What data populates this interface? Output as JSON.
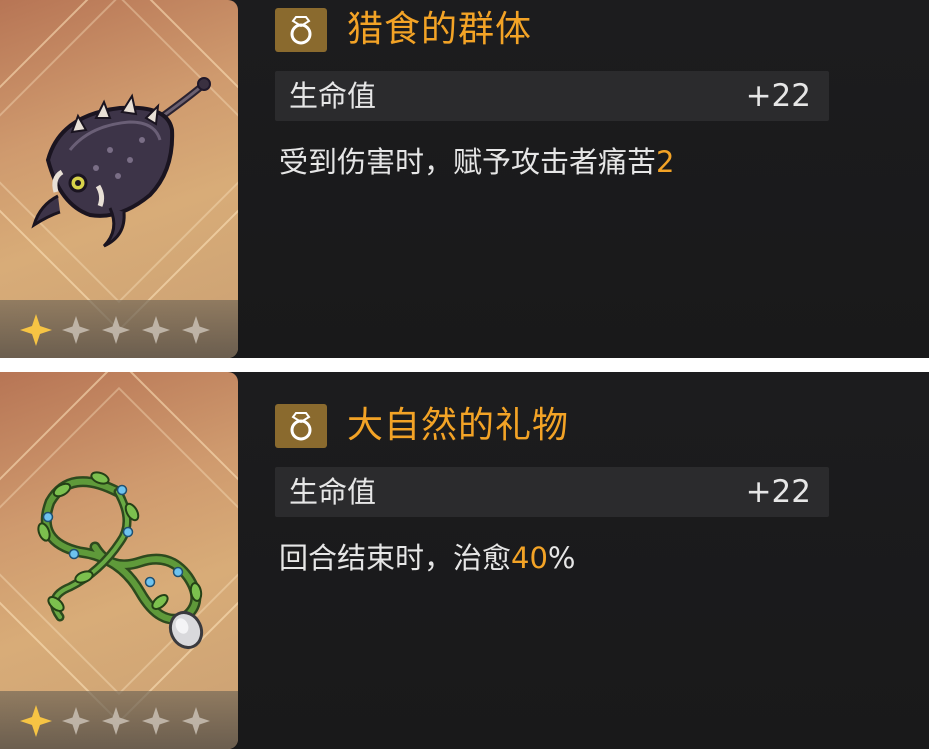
{
  "items": [
    {
      "name": "猎食的群体",
      "stat_label": "生命值",
      "stat_value": "+22",
      "effect_text": "受到伤害时，赋予攻击者痛苦",
      "effect_value": "2",
      "effect_suffix": "",
      "stars": 1,
      "max_stars": 5,
      "icon": "ring-icon",
      "art": "dark-anglerfish-creature"
    },
    {
      "name": "大自然的礼物",
      "stat_label": "生命值",
      "stat_value": "+22",
      "effect_text": "回合结束时，治愈",
      "effect_value": "40",
      "effect_suffix": "%",
      "stars": 1,
      "max_stars": 5,
      "icon": "ring-icon",
      "art": "vine-infinity-amulet"
    }
  ],
  "colors": {
    "accent": "#f3a326",
    "panel": "#1c1c1e",
    "stat_row": "#2b2b2d",
    "icon_bg": "#8a6a2e"
  }
}
